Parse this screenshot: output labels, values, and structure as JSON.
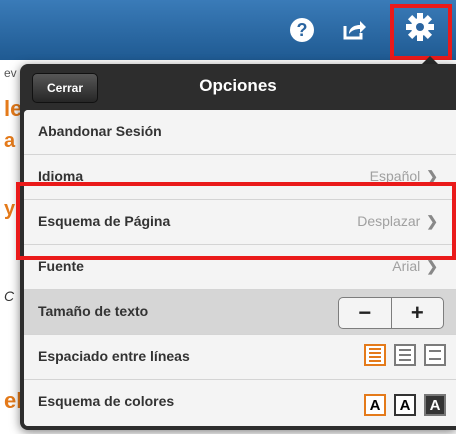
{
  "header": {
    "help_icon_glyph": "?"
  },
  "background": {
    "fragments": [
      "ev",
      "le",
      "a",
      "y",
      "C",
      "el"
    ]
  },
  "panel": {
    "close_label": "Cerrar",
    "title": "Opciones",
    "rows": [
      {
        "label": "Abandonar Sesión"
      },
      {
        "label": "Idioma",
        "value": "Español"
      },
      {
        "label": "Esquema de Página",
        "value": "Desplazar"
      },
      {
        "label": "Fuente",
        "value": "Arial"
      },
      {
        "label": "Tamaño de texto",
        "minus": "−",
        "plus": "+"
      },
      {
        "label": "Espaciado entre líneas"
      },
      {
        "label": "Esquema de colores",
        "options": [
          "A",
          "A",
          "A"
        ]
      }
    ]
  },
  "colors": {
    "header": "#2a64a0",
    "accent": "#e47a1a",
    "highlight": "#ea1a1a"
  }
}
